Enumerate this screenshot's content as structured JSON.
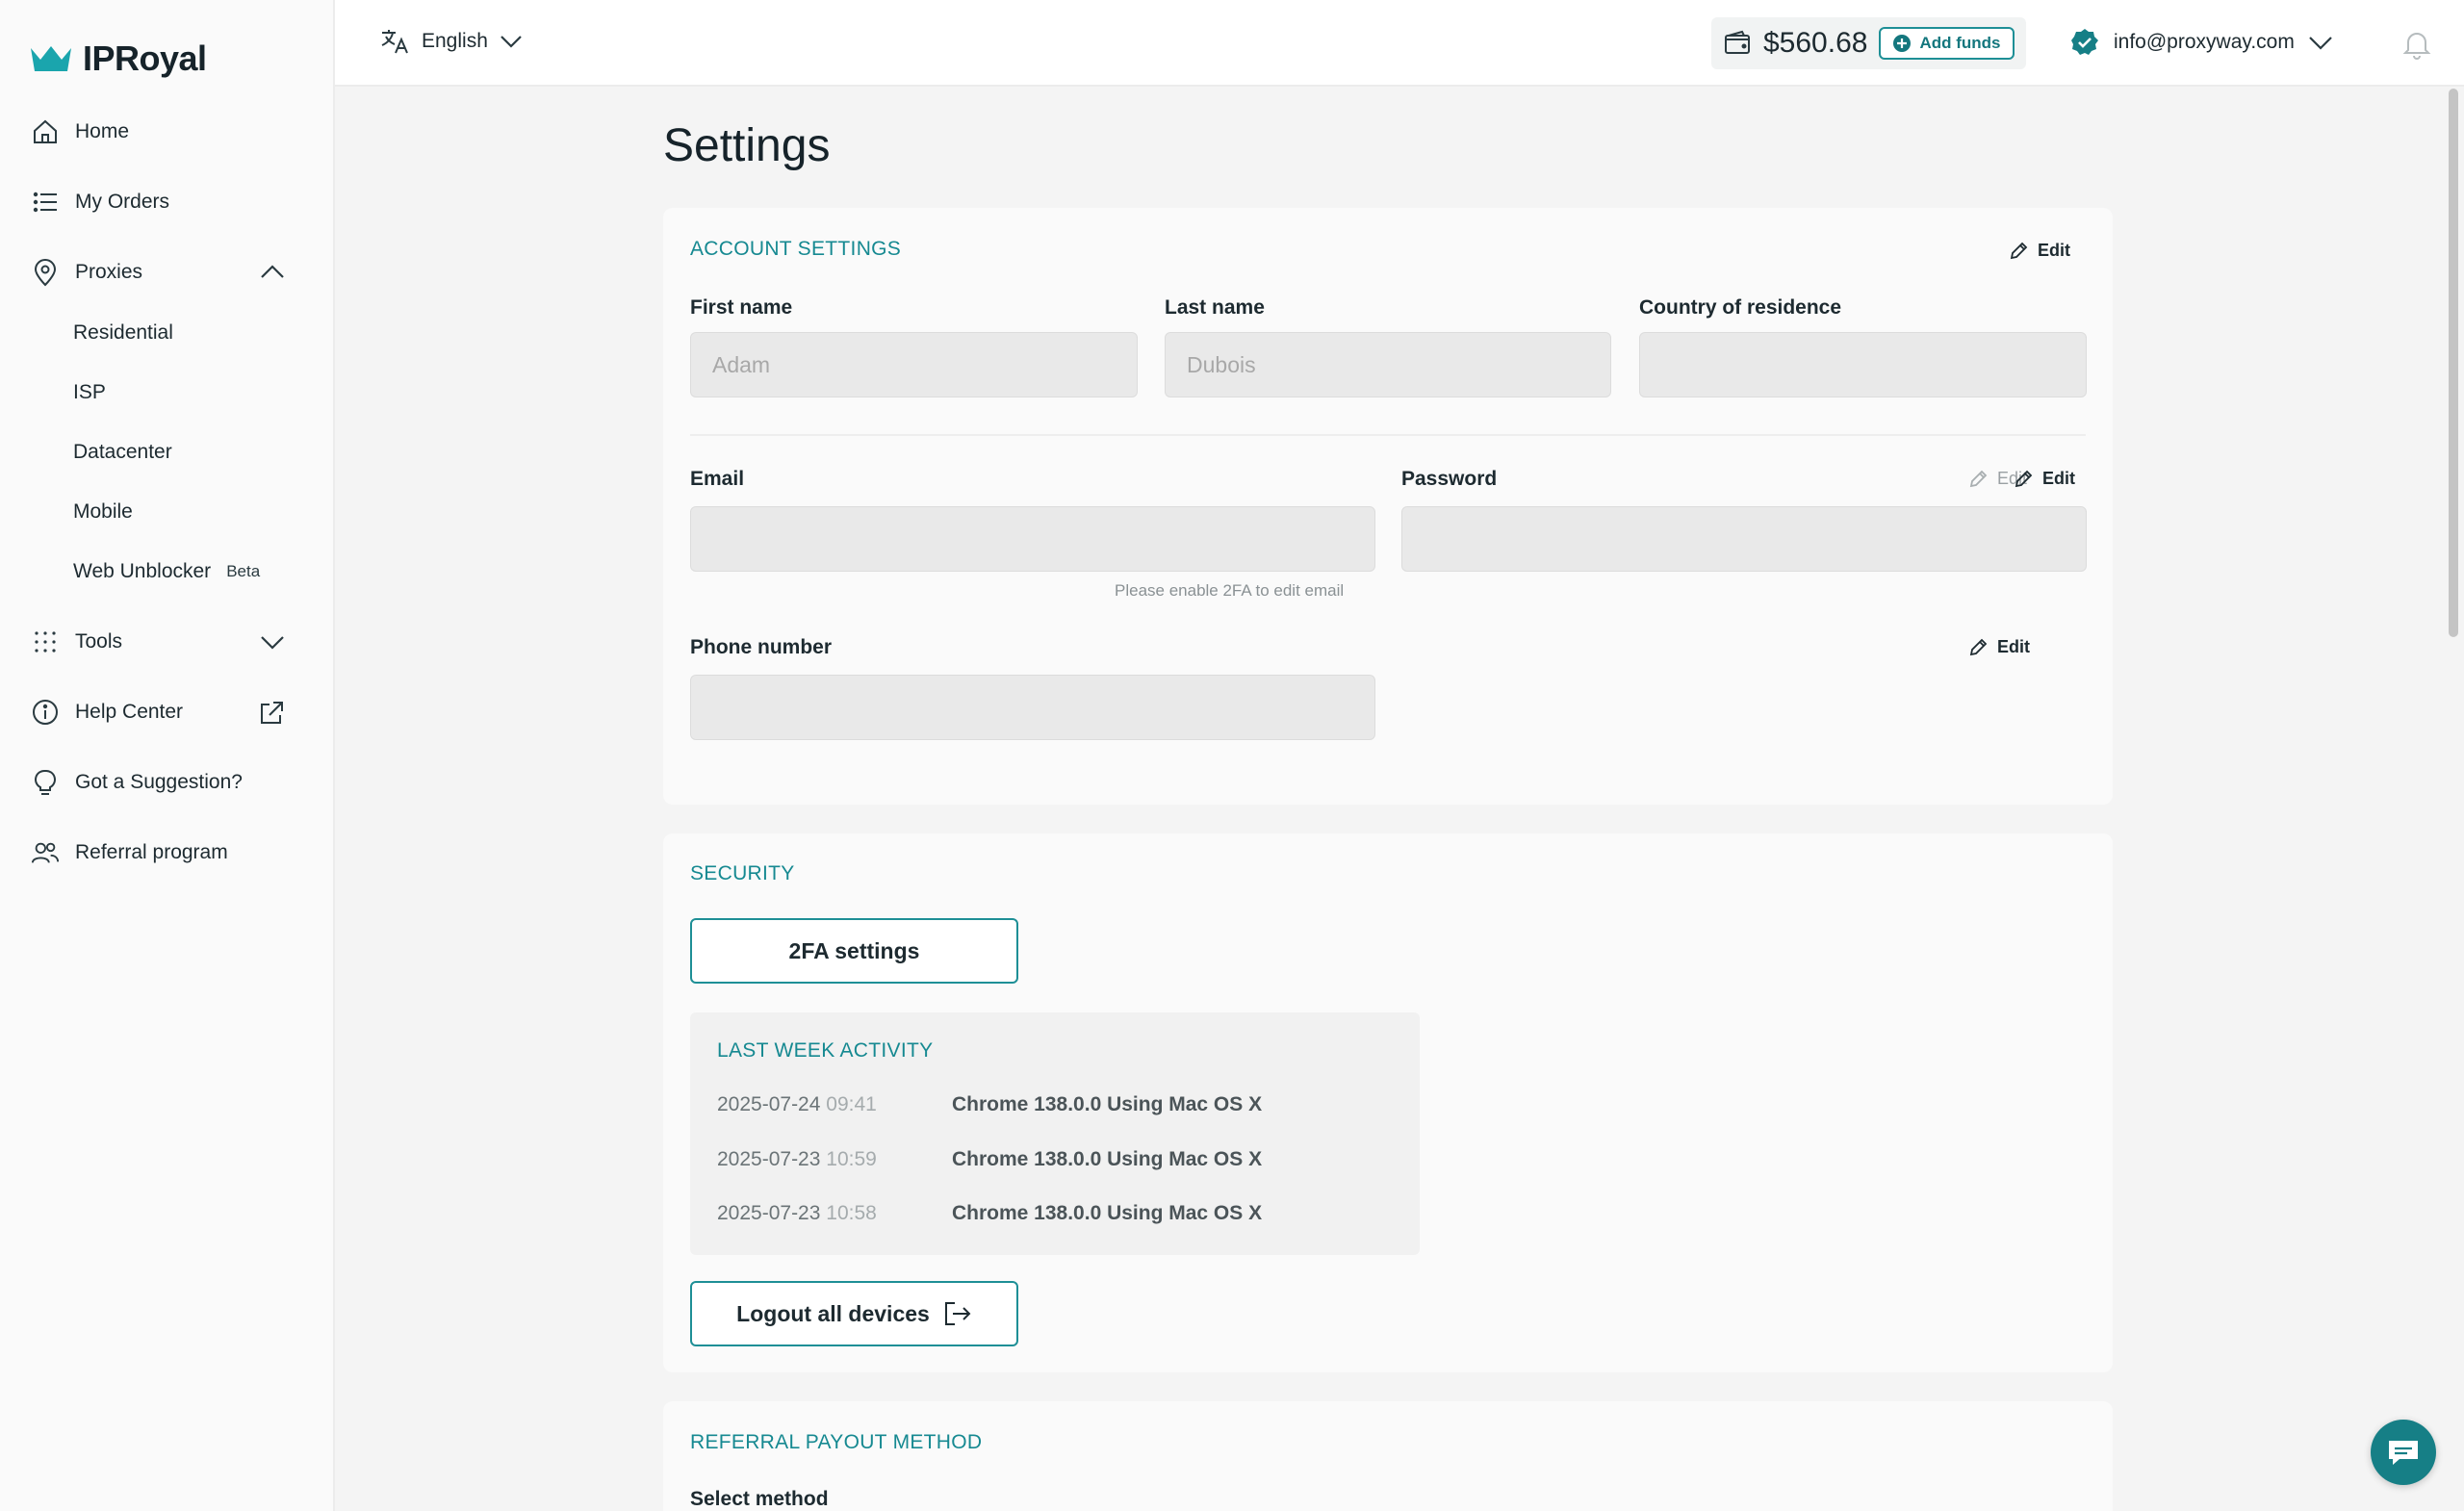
{
  "brand": {
    "name": "IPRoyal",
    "accent": "#1e8f96"
  },
  "sidebar": {
    "items": [
      {
        "label": "Home",
        "icon": "home-icon"
      },
      {
        "label": "My Orders",
        "icon": "list-icon"
      },
      {
        "label": "Proxies",
        "icon": "location-pin-icon"
      },
      {
        "label": "Tools",
        "icon": "grid-dots-icon"
      },
      {
        "label": "Help Center",
        "icon": "info-icon"
      },
      {
        "label": "Got a Suggestion?",
        "icon": "lightbulb-icon"
      },
      {
        "label": "Referral program",
        "icon": "users-icon"
      }
    ],
    "proxies_sub": [
      "Residential",
      "ISP",
      "Datacenter",
      "Mobile",
      "Web Unblocker"
    ],
    "beta_badge": "Beta"
  },
  "topbar": {
    "language": "English",
    "balance": "$560.68",
    "add_funds": "Add funds",
    "user_email": "info@proxyway.com"
  },
  "page": {
    "title": "Settings"
  },
  "account": {
    "title": "ACCOUNT SETTINGS",
    "edit": "Edit",
    "first_name_label": "First name",
    "first_name_value": "Adam",
    "last_name_label": "Last name",
    "last_name_value": "Dubois",
    "country_label": "Country of residence",
    "country_value": "",
    "email_label": "Email",
    "email_value": "",
    "email_hint": "Please enable 2FA to edit email",
    "password_label": "Password",
    "password_value": "",
    "phone_label": "Phone number",
    "phone_value": ""
  },
  "security": {
    "title": "SECURITY",
    "twofa_button": "2FA settings",
    "activity_title": "LAST WEEK ACTIVITY",
    "activity": [
      {
        "date": "2025-07-24",
        "time": "09:41",
        "desc": "Chrome 138.0.0 Using Mac OS X"
      },
      {
        "date": "2025-07-23",
        "time": "10:59",
        "desc": "Chrome 138.0.0 Using Mac OS X"
      },
      {
        "date": "2025-07-23",
        "time": "10:58",
        "desc": "Chrome 138.0.0 Using Mac OS X"
      }
    ],
    "logout_button": "Logout all devices"
  },
  "referral": {
    "title": "REFERRAL PAYOUT METHOD",
    "select_label": "Select method"
  }
}
